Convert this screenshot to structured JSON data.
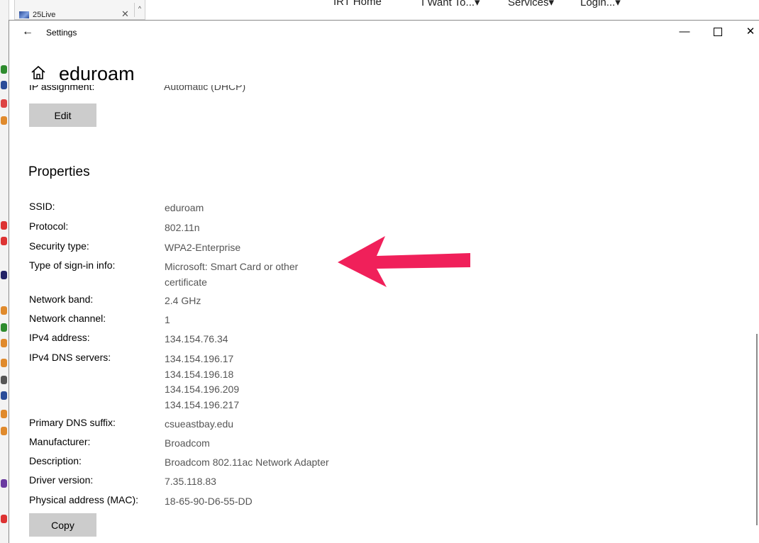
{
  "background": {
    "browser_tab": {
      "title": "25Live",
      "close": "✕",
      "scroll": "^"
    },
    "nav": [
      "IRT Home",
      "I Want To...▾",
      "Services▾",
      "Login...▾"
    ]
  },
  "window": {
    "title": "Settings",
    "back_glyph": "←",
    "minimize_glyph": "—",
    "close_glyph": "✕"
  },
  "page": {
    "title": "eduroam",
    "clipped_row": {
      "label": "IP assignment:",
      "value": "Automatic (DHCP)"
    },
    "edit_button": "Edit",
    "properties_heading": "Properties",
    "copy_button": "Copy"
  },
  "properties": [
    {
      "label": "SSID:",
      "values": [
        "eduroam"
      ]
    },
    {
      "label": "Protocol:",
      "values": [
        "802.11n"
      ]
    },
    {
      "label": "Security type:",
      "values": [
        "WPA2-Enterprise"
      ]
    },
    {
      "label": "Type of sign-in info:",
      "values": [
        "Microsoft: Smart Card or other",
        "certificate"
      ]
    },
    {
      "label": "Network band:",
      "values": [
        "2.4 GHz"
      ]
    },
    {
      "label": "Network channel:",
      "values": [
        "1"
      ]
    },
    {
      "label": "IPv4 address:",
      "values": [
        "134.154.76.34"
      ]
    },
    {
      "label": "IPv4 DNS servers:",
      "values": [
        "134.154.196.17",
        "134.154.196.18",
        "134.154.196.209",
        "134.154.196.217"
      ]
    },
    {
      "label": "Primary DNS suffix:",
      "values": [
        "csueastbay.edu"
      ]
    },
    {
      "label": "Manufacturer:",
      "values": [
        "Broadcom"
      ]
    },
    {
      "label": "Description:",
      "values": [
        "Broadcom 802.11ac Network Adapter"
      ]
    },
    {
      "label": "Driver version:",
      "values": [
        "7.35.118.83"
      ]
    },
    {
      "label": "Physical address (MAC):",
      "values": [
        "18-65-90-D6-55-DD"
      ]
    }
  ],
  "colors": {
    "annotation_arrow": "#f0205a",
    "button_bg": "#cccccc",
    "value_text": "#555555"
  }
}
